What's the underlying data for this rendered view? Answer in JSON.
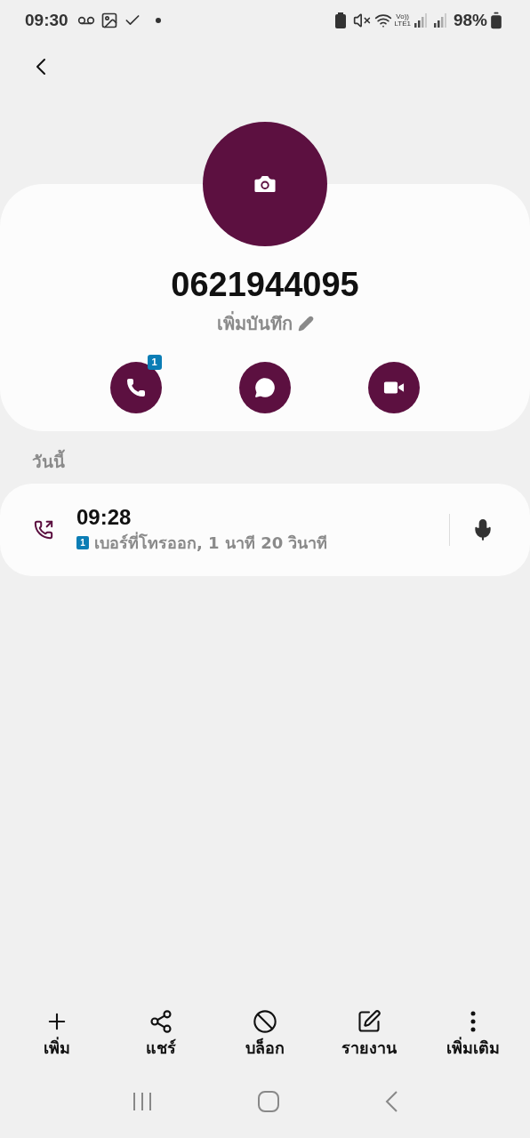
{
  "status_bar": {
    "time": "09:30",
    "volte_top": "Vo))",
    "volte_bottom": "LTE1",
    "battery": "98%"
  },
  "contact": {
    "number": "0621944095",
    "note_link": "เพิ่มบันทึก"
  },
  "actions": [
    {
      "kind": "call",
      "badge": "1"
    },
    {
      "kind": "message"
    },
    {
      "kind": "video"
    }
  ],
  "history": {
    "heading": "วันนี้",
    "entries": [
      {
        "time": "09:28",
        "sim": "1",
        "detail": "เบอร์ที่โทรออก, 1 นาที 20 วินาที"
      }
    ]
  },
  "toolbar": [
    {
      "kind": "add",
      "label": "เพิ่ม"
    },
    {
      "kind": "share",
      "label": "แชร์"
    },
    {
      "kind": "block",
      "label": "บล็อก"
    },
    {
      "kind": "report",
      "label": "รายงาน"
    },
    {
      "kind": "more",
      "label": "เพิ่มเติม"
    }
  ]
}
